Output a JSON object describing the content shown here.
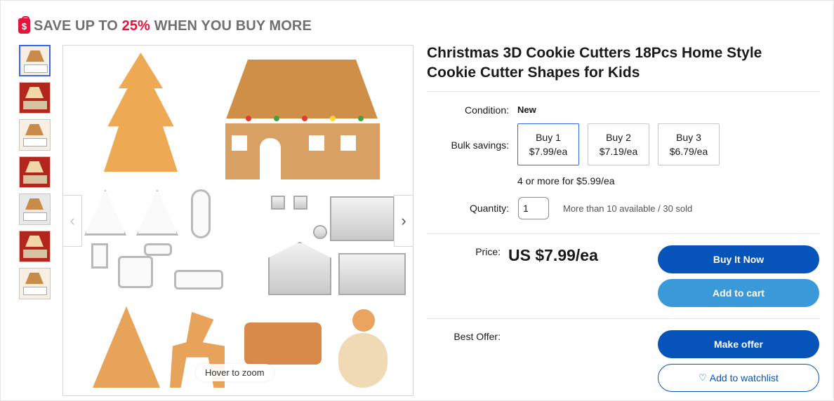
{
  "promo": {
    "icon": "price-tag-icon",
    "prefix": "SAVE UP TO ",
    "highlight": "25%",
    "suffix": " WHEN YOU BUY MORE",
    "highlight_color": "#e0173b"
  },
  "gallery": {
    "thumbnail_count": 7,
    "zoom_hint": "Hover to zoom",
    "prev_label": "‹",
    "next_label": "›"
  },
  "product": {
    "title": "Christmas 3D Cookie Cutters 18Pcs Home Style Cookie Cutter Shapes for Kids"
  },
  "details": {
    "condition_label": "Condition:",
    "condition_value": "New",
    "bulk_label": "Bulk savings:",
    "bulk_options": [
      {
        "qty": "Buy 1",
        "price": "$7.99/ea"
      },
      {
        "qty": "Buy 2",
        "price": "$7.19/ea"
      },
      {
        "qty": "Buy 3",
        "price": "$6.79/ea"
      }
    ],
    "bulk_more": "4 or more for $5.99/ea",
    "quantity_label": "Quantity:",
    "quantity_value": "1",
    "availability": "More than 10 available / 30 sold"
  },
  "purchase": {
    "price_label": "Price:",
    "price_value": "US $7.99/ea",
    "buy_now": "Buy It Now",
    "add_to_cart": "Add to cart",
    "best_offer_label": "Best Offer:",
    "make_offer": "Make offer",
    "watchlist": "Add to watchlist"
  },
  "colors": {
    "primary": "#0654ba",
    "secondary": "#3a9ad9",
    "selected_border": "#3665f3"
  }
}
